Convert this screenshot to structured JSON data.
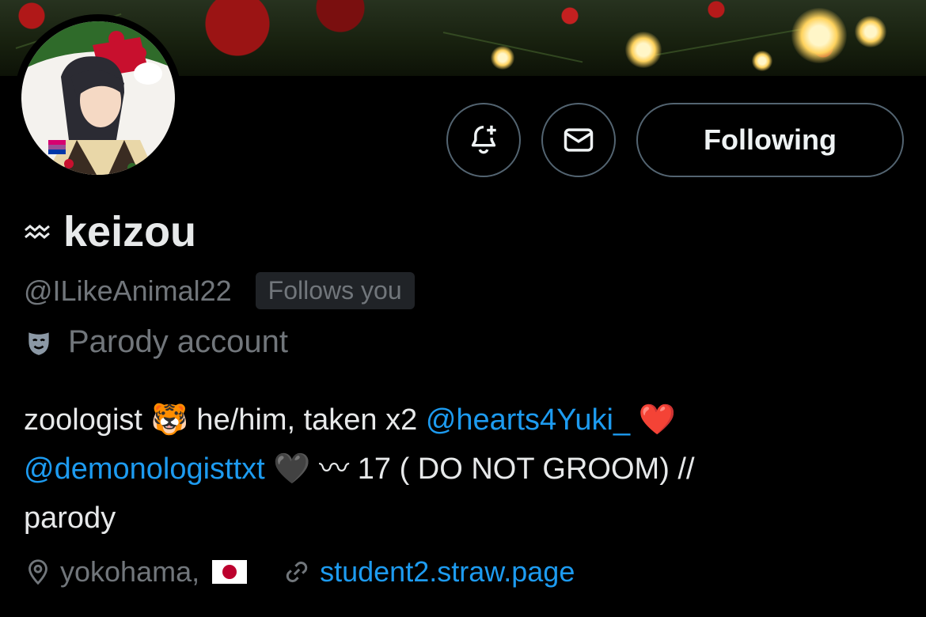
{
  "profile": {
    "name_prefix_icon": "aquarius-icon",
    "name": "keizou",
    "handle": "@ILikeAnimal22",
    "follows_you": "Follows you",
    "parody_label": "Parody account",
    "location": "yokohama,",
    "website": "student2.straw.page"
  },
  "actions": {
    "notify_icon": "bell-plus-icon",
    "message_icon": "envelope-icon",
    "following_label": "Following"
  },
  "bio": {
    "part1": "zoologist ",
    "part2": " he/him, taken x2 ",
    "mention1": "@hearts4Yuki_",
    "mention2": "@demonologisttxt",
    "part3": " 〰 17 ( DO NOT GROOM) //",
    "part4": "parody",
    "emoji_tiger": "🐯",
    "emoji_heart_red": "❤️",
    "emoji_heart_black": "🖤",
    "emoji_flag": "🇯🇵"
  },
  "colors": {
    "accent": "#1d9bf0",
    "secondary_text": "#71767b",
    "border": "#536471"
  }
}
